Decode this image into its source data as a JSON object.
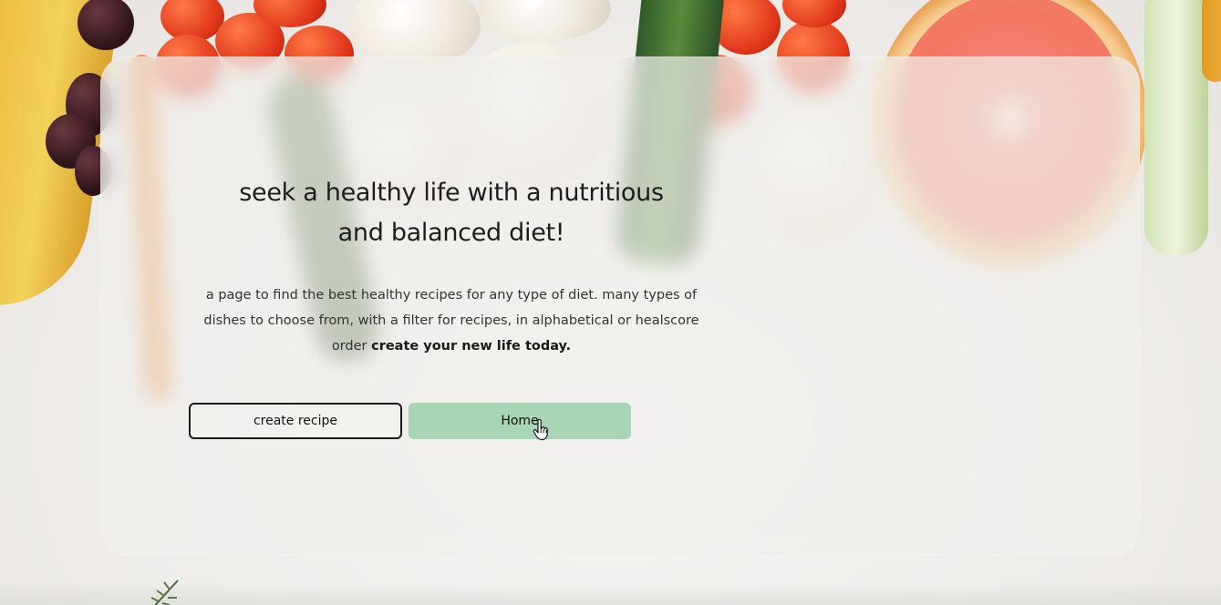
{
  "hero": {
    "headline": "seek a healthy life with a nutritious and balanced diet!",
    "description": "a page to find the best healthy recipes for any type of diet. many types of dishes to choose from, with a filter for recipes, in alphabetical or healscore order",
    "description_emphasis": "create your new life today."
  },
  "actions": {
    "create_recipe_label": "create recipe",
    "home_label": "Home"
  },
  "colors": {
    "home_button": "#a8d5b5",
    "create_button_border": "#1b1b1b"
  },
  "icons": {
    "cursor": "hand-pointer-icon"
  }
}
